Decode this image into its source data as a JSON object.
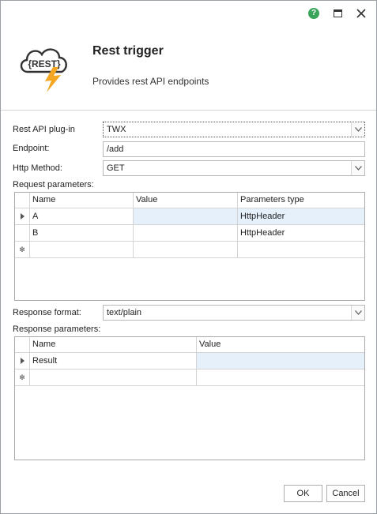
{
  "titlebar": {
    "help_icon": "help-icon",
    "maximize_icon": "maximize-icon",
    "close_icon": "close-icon",
    "help_color": "#3aa55a"
  },
  "header": {
    "logo_text": "{REST}",
    "title": "Rest trigger",
    "subtitle": "Provides rest API endpoints",
    "bolt_color": "#f5a623"
  },
  "form": {
    "plugin_label": "Rest API plug-in",
    "plugin_value": "TWX",
    "endpoint_label": "Endpoint:",
    "endpoint_value": "/add",
    "method_label": "Http Method:",
    "method_value": "GET",
    "request_label": "Request parameters:",
    "response_format_label": "Response format:",
    "response_format_value": "text/plain",
    "response_label": "Response parameters:"
  },
  "request_grid": {
    "columns": [
      "Name",
      "Value",
      "Parameters type"
    ],
    "rows": [
      {
        "name": "A",
        "value": "",
        "type": "HttpHeader"
      },
      {
        "name": "B",
        "value": "",
        "type": "HttpHeader"
      }
    ]
  },
  "response_grid": {
    "columns": [
      "Name",
      "Value"
    ],
    "rows": [
      {
        "name": "Result",
        "value": ""
      }
    ]
  },
  "buttons": {
    "ok": "OK",
    "cancel": "Cancel"
  }
}
